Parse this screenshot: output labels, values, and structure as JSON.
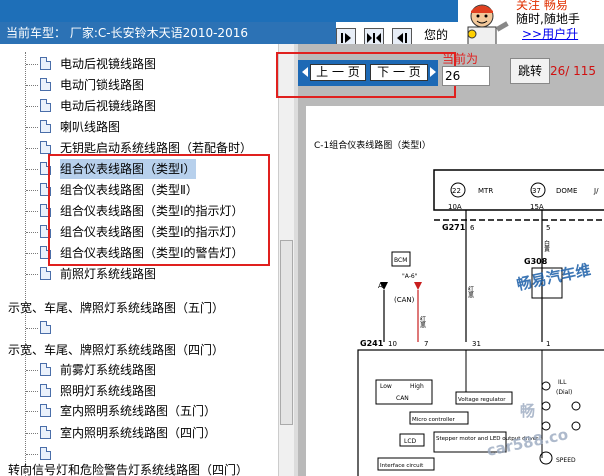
{
  "status": {
    "current_model": "当前车型：  厂家:C-长安铃木天语2010-2016",
    "nine_text": "您的"
  },
  "toolbar": {
    "btn1_icon": "arrow-right-icon",
    "btn2_icon": "split-icon",
    "btn3_icon": "arrow-left-icon"
  },
  "ad": {
    "line1": "关注  畅易",
    "line2": "随时,随地手",
    "link": ">>用户升"
  },
  "tree": {
    "items": [
      {
        "label": "电动后视镜线路图",
        "indent": 1
      },
      {
        "label": "电动门锁线路图",
        "indent": 1
      },
      {
        "label": "电动后视镜线路图",
        "indent": 1
      },
      {
        "label": "喇叭线路图",
        "indent": 1
      },
      {
        "label": "无钥匙启动系统线路图（若配备时）",
        "indent": 1
      },
      {
        "label": "组合仪表线路图（类型Ⅰ）",
        "indent": 1,
        "selected": true
      },
      {
        "label": "组合仪表线路图（类型Ⅱ）",
        "indent": 1
      },
      {
        "label": "组合仪表线路图（类型Ⅰ的指示灯）",
        "indent": 1
      },
      {
        "label": "组合仪表线路图（类型Ⅰ的指示灯）",
        "indent": 1
      },
      {
        "label": "组合仪表线路图（类型Ⅰ的警告灯）",
        "indent": 1
      },
      {
        "label": "前照灯系统线路图",
        "indent": 1
      },
      {
        "label": "示宽、车尾、牌照灯系统线路图（五门）",
        "indent": 0
      },
      {
        "label": "",
        "indent": 1
      },
      {
        "label": "示宽、车尾、牌照灯系统线路图（四门）",
        "indent": 0
      },
      {
        "label": "前雾灯系统线路图",
        "indent": 1
      },
      {
        "label": "照明灯系统线路图",
        "indent": 1
      },
      {
        "label": "室内照明系统线路图（五门）",
        "indent": 1
      },
      {
        "label": "室内照明系统线路图（四门）",
        "indent": 1
      },
      {
        "label": "",
        "indent": 1
      },
      {
        "label": "转向信号灯和危险警告灯系统线路图（四门）",
        "indent": 0
      }
    ]
  },
  "viewer": {
    "prev_label": "上 一 页",
    "next_label": "下 一 页",
    "page_label": "当前为",
    "page_value": "26",
    "goto_label": "跳转",
    "page_count": "26/ 115"
  },
  "diagram": {
    "title": "C-1组合仪表线路图（类型Ⅰ）",
    "fuse1_num": "22",
    "fuse1_name": "MTR",
    "fuse1_amp": "10A",
    "fuse2_num": "37",
    "fuse2_name": "DOME",
    "fuse2_amp": "15A",
    "fuse3_name": "J/",
    "g271": "G271",
    "g271_pin": "6",
    "g308": "G308",
    "g308_pin": "5",
    "bcm": "BCM",
    "a6": "\"A-6\"",
    "pin_a": "A",
    "can": "(CAN)",
    "wire_hong": "红黑",
    "wire_bai": "白黄",
    "g241": "G241",
    "g241_pin1": "10",
    "g241_pin2": "7",
    "g241_pin3": "31",
    "g241_pin4": "1",
    "low": "Low",
    "high": "High",
    "can2": "CAN",
    "volt": "Voltage regulator",
    "micro": "Micro controller",
    "lcd": "LCD",
    "stepper": "Stepper motor and LED output driver",
    "iface": "Interface circuit",
    "ill": "ILL",
    "dial": "(Dial)",
    "speed": "SPEED",
    "watermark1": "畅易汽车维",
    "watermark2": "畅",
    "watermark3": "car588.co"
  }
}
